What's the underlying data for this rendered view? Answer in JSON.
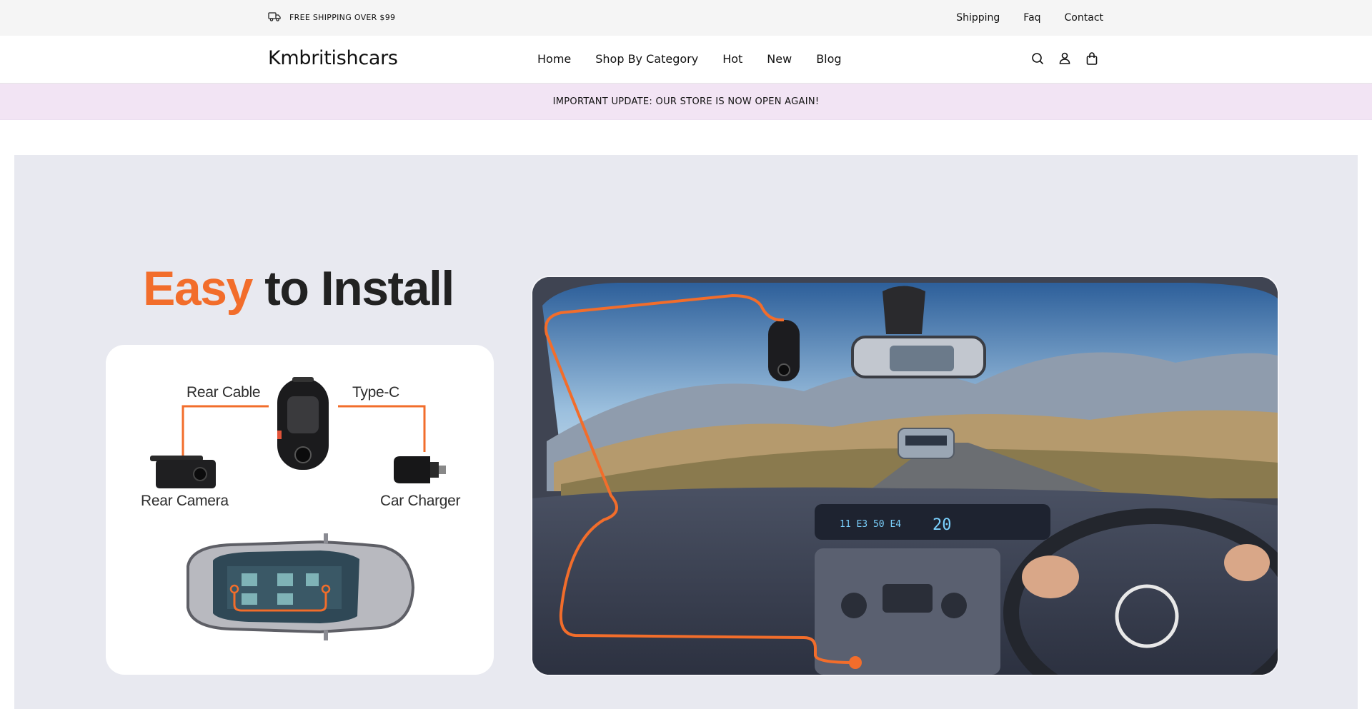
{
  "topbar": {
    "shipping_text": "FREE SHIPPING OVER $99",
    "links": [
      "Shipping",
      "Faq",
      "Contact"
    ]
  },
  "header": {
    "logo": "Kmbritishcars",
    "nav": [
      "Home",
      "Shop By Category",
      "Hot",
      "New",
      "Blog"
    ],
    "icons": [
      "search-icon",
      "account-icon",
      "cart-icon"
    ]
  },
  "announcement": "IMPORTANT UPDATE: OUR STORE IS NOW OPEN AGAIN!",
  "hero": {
    "heading_accent": "Easy",
    "heading_rest": "to Install",
    "diagram_labels": {
      "rear_cable": "Rear Cable",
      "type_c": "Type-C",
      "rear_camera": "Rear Camera",
      "car_charger": "Car Charger"
    }
  },
  "colors": {
    "accent": "#f26d2b",
    "announcement_bg": "#f2e4f4",
    "hero_bg": "#e8e9f0",
    "topbar_bg": "#f5f5f5"
  }
}
